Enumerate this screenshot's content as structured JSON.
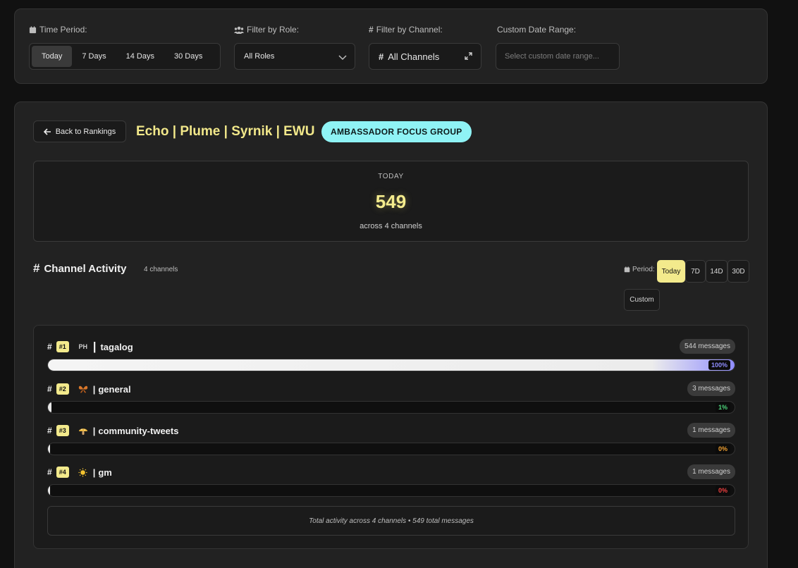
{
  "filters": {
    "time_period": {
      "label": "Time Period:",
      "options": [
        "Today",
        "7 Days",
        "14 Days",
        "30 Days"
      ],
      "selected": "Today"
    },
    "role": {
      "label": "Filter by Role:",
      "value": "All Roles"
    },
    "channel": {
      "label": "Filter by Channel:",
      "value": "All Channels"
    },
    "date_range": {
      "label": "Custom Date Range:",
      "placeholder": "Select custom date range..."
    }
  },
  "detail": {
    "back_label": "Back to Rankings",
    "group_name": "Echo | Plume | Syrnik | EWU",
    "group_badge": "AMBASSADOR FOCUS GROUP",
    "stat": {
      "label": "TODAY",
      "value": "549",
      "sub": "across 4 channels"
    },
    "section": {
      "title": "Channel Activity",
      "count": "4 channels"
    },
    "period": {
      "label": "Period:",
      "options": [
        "Today",
        "7D",
        "14D",
        "30D",
        "Custom"
      ],
      "selected": "Today"
    },
    "channels": [
      {
        "rank": "#1",
        "emoji": "PH",
        "name": "tagalog",
        "separator": "|",
        "messages": "544 messages",
        "percent_label": "100%",
        "fill_fraction": 1.0,
        "pct_color": "#8f8cff"
      },
      {
        "rank": "#2",
        "emoji": "butterfly",
        "name": "general",
        "separator": "|",
        "messages": "3 messages",
        "percent_label": "1%",
        "fill_fraction": 0.0055,
        "pct_color": "#4cd37a"
      },
      {
        "rank": "#3",
        "emoji": "mushroom",
        "name": "community-tweets",
        "separator": "|",
        "messages": "1 messages",
        "percent_label": "0%",
        "fill_fraction": 0.0018,
        "pct_color": "#f0a030"
      },
      {
        "rank": "#4",
        "emoji": "sun",
        "name": "gm",
        "separator": "|",
        "messages": "1 messages",
        "percent_label": "0%",
        "fill_fraction": 0.0018,
        "pct_color": "#f04040"
      }
    ],
    "footer": "Total activity across 4 channels • 549 total messages"
  }
}
